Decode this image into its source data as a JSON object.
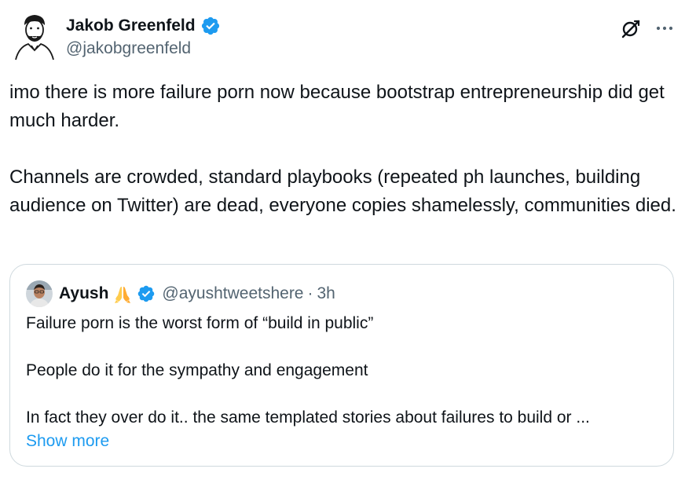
{
  "author": {
    "name": "Jakob Greenfeld",
    "handle": "@jakobgreenfeld",
    "avatar_icon": "person-illustration-avatar",
    "verified": true
  },
  "header_actions": {
    "grok_icon": "grok-icon",
    "more_icon": "more-horizontal-icon"
  },
  "tweet": {
    "paragraphs": [
      "imo there is more failure porn now because bootstrap entrepreneurship did get much harder.",
      "Channels are crowded, standard playbooks (repeated ph launches, building audience on Twitter) are dead, everyone copies shamelessly, communities died."
    ]
  },
  "quote": {
    "name": "Ayush",
    "emoji": "🙏",
    "handle": "@ayushtweetshere",
    "separator": "·",
    "time": "3h",
    "verified": true,
    "paragraphs": [
      "Failure porn is the worst form of “build in public”",
      "People do it for the sympathy and engagement",
      "In fact they over do it.. the same templated stories about failures to build or ..."
    ],
    "show_more": "Show more"
  },
  "colors": {
    "text": "#0f1419",
    "secondary": "#536471",
    "link": "#1d9bf0",
    "border": "#cfd9de",
    "verified": "#1d9bf0"
  }
}
